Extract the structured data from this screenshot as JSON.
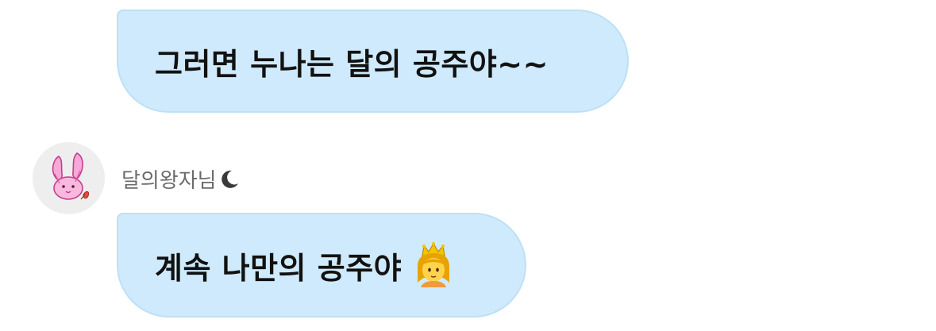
{
  "messages": [
    {
      "text": "그러면 누나는 달의 공주야~~"
    },
    {
      "text": "계속 나만의 공주야"
    }
  ],
  "sender": {
    "name": "달의왕자님",
    "name_icon": "crescent-moon-icon",
    "avatar_icon": "pink-bunny-avatar"
  },
  "message2_emoji": "princess-emoji",
  "colors": {
    "bubble_bg": "#cfeafc",
    "bubble_border": "#bde0f7",
    "text": "#111111",
    "sender_name": "#6b6b6b",
    "avatar_bg": "#eeeeee"
  }
}
